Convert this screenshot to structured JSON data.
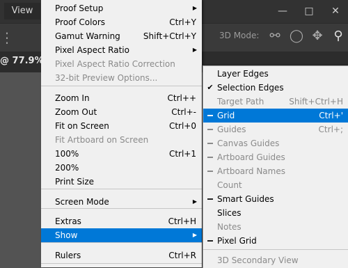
{
  "app": {
    "menubar_view": "View",
    "options_3d_mode": "3D Mode:",
    "document_tab": "@ 77.9% (",
    "document_tab_arrow": "»"
  },
  "icons": {
    "minimize": "minimize-icon",
    "maximize": "maximize-icon",
    "close": "close-icon",
    "orbit": "orbit-3d-icon",
    "roll": "roll-3d-icon",
    "pan": "pan-3d-icon",
    "search": "search-icon"
  },
  "view_menu": {
    "items": [
      {
        "label": "Proof Setup",
        "shortcut": "",
        "submenu": true,
        "disabled": false
      },
      {
        "label": "Proof Colors",
        "shortcut": "Ctrl+Y",
        "submenu": false,
        "disabled": false
      },
      {
        "label": "Gamut Warning",
        "shortcut": "Shift+Ctrl+Y",
        "submenu": false,
        "disabled": false
      },
      {
        "label": "Pixel Aspect Ratio",
        "shortcut": "",
        "submenu": true,
        "disabled": false
      },
      {
        "label": "Pixel Aspect Ratio Correction",
        "shortcut": "",
        "submenu": false,
        "disabled": true
      },
      {
        "label": "32-bit Preview Options...",
        "shortcut": "",
        "submenu": false,
        "disabled": true
      },
      {
        "label": "Zoom In",
        "shortcut": "Ctrl++",
        "submenu": false,
        "disabled": false
      },
      {
        "label": "Zoom Out",
        "shortcut": "Ctrl+-",
        "submenu": false,
        "disabled": false
      },
      {
        "label": "Fit on Screen",
        "shortcut": "Ctrl+0",
        "submenu": false,
        "disabled": false
      },
      {
        "label": "Fit Artboard on Screen",
        "shortcut": "",
        "submenu": false,
        "disabled": true
      },
      {
        "label": "100%",
        "shortcut": "Ctrl+1",
        "submenu": false,
        "disabled": false
      },
      {
        "label": "200%",
        "shortcut": "",
        "submenu": false,
        "disabled": false
      },
      {
        "label": "Print Size",
        "shortcut": "",
        "submenu": false,
        "disabled": false
      },
      {
        "label": "Screen Mode",
        "shortcut": "",
        "submenu": true,
        "disabled": false
      },
      {
        "label": "Extras",
        "shortcut": "Ctrl+H",
        "submenu": false,
        "disabled": false
      },
      {
        "label": "Show",
        "shortcut": "",
        "submenu": true,
        "disabled": false,
        "highlighted": true
      },
      {
        "label": "Rulers",
        "shortcut": "Ctrl+R",
        "submenu": false,
        "disabled": false
      }
    ]
  },
  "show_submenu": {
    "items": [
      {
        "label": "Layer Edges",
        "shortcut": "",
        "mark": "",
        "disabled": false
      },
      {
        "label": "Selection Edges",
        "shortcut": "",
        "mark": "check",
        "disabled": false
      },
      {
        "label": "Target Path",
        "shortcut": "Shift+Ctrl+H",
        "mark": "",
        "disabled": true
      },
      {
        "label": "Grid",
        "shortcut": "Ctrl+'",
        "mark": "dash",
        "disabled": false,
        "highlighted": true
      },
      {
        "label": "Guides",
        "shortcut": "Ctrl+;",
        "mark": "dash",
        "disabled": true
      },
      {
        "label": "Canvas Guides",
        "shortcut": "",
        "mark": "dash",
        "disabled": true
      },
      {
        "label": "Artboard Guides",
        "shortcut": "",
        "mark": "dash",
        "disabled": true
      },
      {
        "label": "Artboard Names",
        "shortcut": "",
        "mark": "dash",
        "disabled": true
      },
      {
        "label": "Count",
        "shortcut": "",
        "mark": "",
        "disabled": true
      },
      {
        "label": "Smart Guides",
        "shortcut": "",
        "mark": "dash",
        "disabled": false
      },
      {
        "label": "Slices",
        "shortcut": "",
        "mark": "",
        "disabled": false
      },
      {
        "label": "Notes",
        "shortcut": "",
        "mark": "",
        "disabled": true
      },
      {
        "label": "Pixel Grid",
        "shortcut": "",
        "mark": "dash",
        "disabled": false
      },
      {
        "label": "3D Secondary View",
        "shortcut": "",
        "mark": "",
        "disabled": true
      }
    ]
  },
  "colors": {
    "highlight": "#0078d7",
    "menu_bg": "#f0f0f0",
    "disabled_text": "#8a8a8a",
    "app_bar": "#323232"
  }
}
